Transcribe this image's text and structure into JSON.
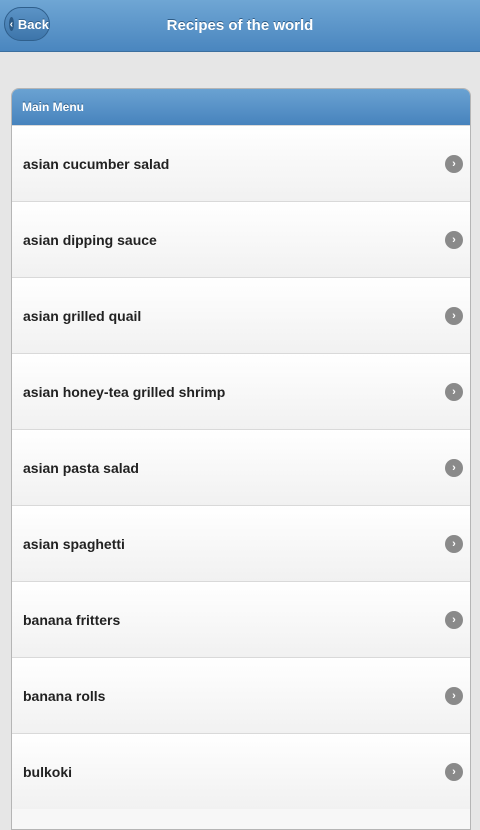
{
  "header": {
    "back_label": "Back",
    "title": "Recipes of the world"
  },
  "menu": {
    "title": "Main Menu",
    "items": [
      {
        "label": "asian cucumber salad"
      },
      {
        "label": "asian dipping sauce"
      },
      {
        "label": "asian grilled quail"
      },
      {
        "label": "asian honey-tea grilled shrimp"
      },
      {
        "label": "asian pasta salad"
      },
      {
        "label": "asian spaghetti"
      },
      {
        "label": "banana fritters"
      },
      {
        "label": "banana rolls"
      },
      {
        "label": "bulkoki"
      }
    ]
  },
  "icons": {
    "back": "chevron-left-icon",
    "item": "chevron-right-icon"
  },
  "colors": {
    "header": "#4a86bf",
    "background": "#e6e6e6"
  }
}
